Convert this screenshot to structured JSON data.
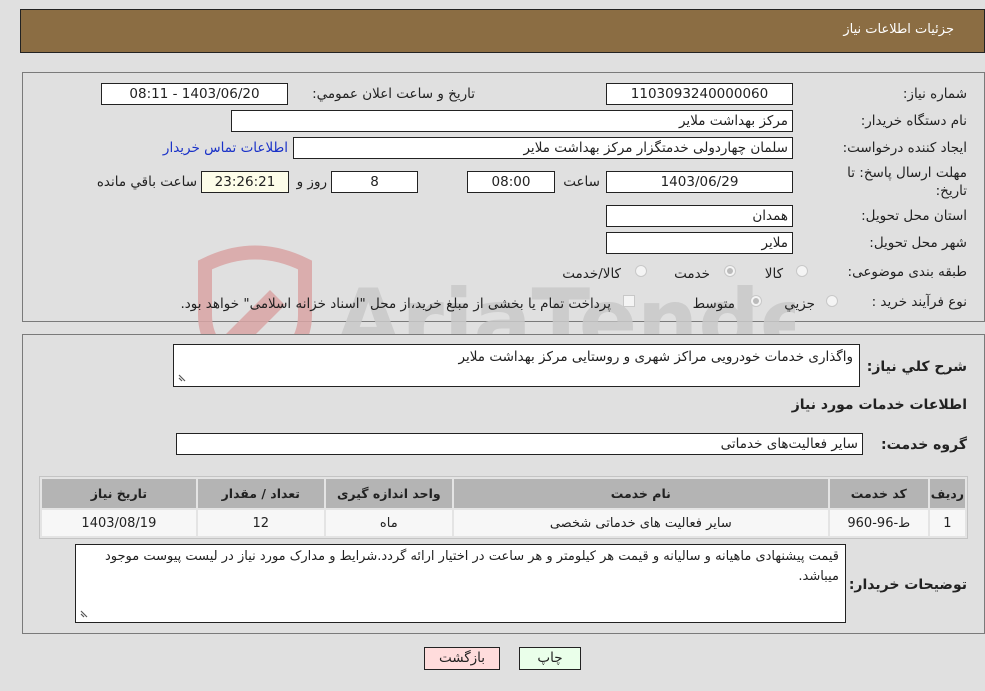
{
  "header": {
    "title": "جزئيات اطلاعات نياز"
  },
  "fields": {
    "need_number": {
      "label": "شماره نياز:",
      "value": "1103093240000060"
    },
    "announce_datetime": {
      "label": "تاريخ و ساعت اعلان عمومي:",
      "value": "1403/06/20 - 08:11"
    },
    "buyer_org": {
      "label": "نام دستگاه خريدار:",
      "value": "مرکز بهداشت ملاير"
    },
    "requester": {
      "label": "ايجاد کننده درخواست:",
      "value": "سلمان چهاردولی خدمتگزار مرکز بهداشت ملاير",
      "contact_link": "اطلاعات تماس خريدار"
    },
    "deadline": {
      "label_line1": "مهلت ارسال پاسخ: تا",
      "label_line2": "تاريخ:",
      "date": "1403/06/29",
      "time_label": "ساعت",
      "time": "08:00",
      "days": "8",
      "days_label": "روز و",
      "remaining": "23:26:21",
      "remaining_label": "ساعت باقي مانده"
    },
    "province": {
      "label": "استان محل تحويل:",
      "value": "همدان"
    },
    "city": {
      "label": "شهر محل تحويل:",
      "value": "ملاير"
    },
    "category": {
      "label": "طبقه بندی موضوعی:",
      "options": [
        {
          "label": "کالا",
          "selected": false
        },
        {
          "label": "خدمت",
          "selected": true
        },
        {
          "label": "کالا/خدمت",
          "selected": false
        }
      ]
    },
    "purchase_type": {
      "label": "نوع فرآيند خريد :",
      "options": [
        {
          "label": "جزيي",
          "selected": false
        },
        {
          "label": "متوسط",
          "selected": true
        }
      ],
      "treasury_checkbox_label": "پرداخت تمام يا بخشی از مبلغ خريد،از محل \"اسناد خزانه اسلامی\" خواهد بود.",
      "treasury_checked": false
    }
  },
  "description": {
    "label": "شرح کلي نياز:",
    "value": "واگذاری خدمات خودرویی مراکز شهری و روستایی مرکز بهداشت ملاير"
  },
  "services": {
    "section_title": "اطلاعات خدمات مورد نياز",
    "group_label": "گروه خدمت:",
    "group_value": "ساير فعاليت‌های خدماتی",
    "table": {
      "headers": [
        "رديف",
        "کد خدمت",
        "نام خدمت",
        "واحد اندازه گيری",
        "تعداد / مقدار",
        "تاريخ نياز"
      ],
      "rows": [
        [
          "1",
          "ط-96-960",
          "ساير فعاليت های خدماتی شخصی",
          "ماه",
          "12",
          "1403/08/19"
        ]
      ]
    }
  },
  "buyer_notes": {
    "label": "توضيحات خريدار:",
    "value": "قيمت پيشنهادی ماهيانه و ساليانه و قيمت هر کيلومتر و هر ساعت در اختيار ارائه گردد.شرايط و  مدارک مورد نياز در ليست پيوست موجود ميباشد."
  },
  "buttons": {
    "print": "چاپ",
    "back": "بازگشت"
  },
  "watermark": {
    "text": "AriaTender.net"
  },
  "colors": {
    "header_bg": "#8b6d43",
    "link": "#1a32c8",
    "back_btn": "#ffdcdc",
    "print_btn": "#eaffea"
  }
}
